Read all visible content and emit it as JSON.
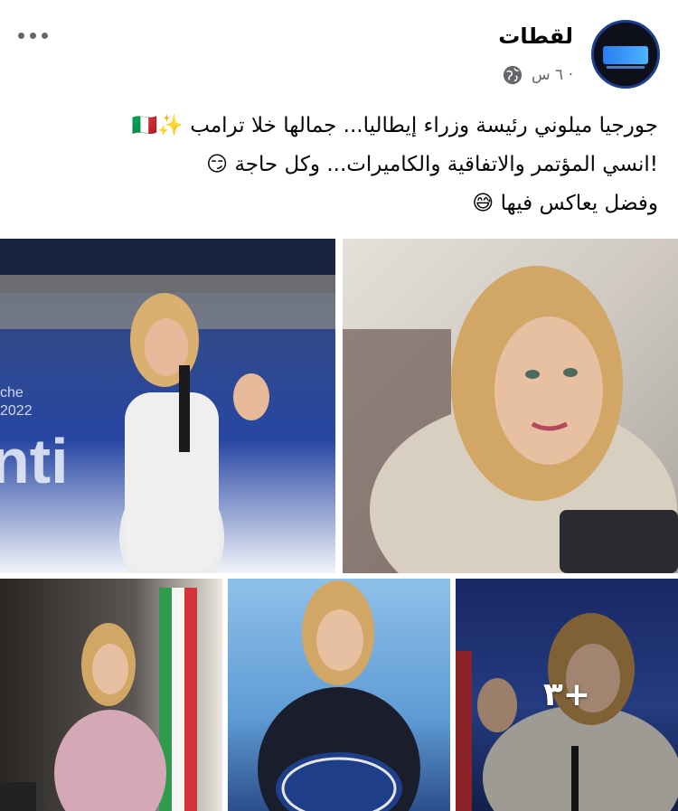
{
  "post": {
    "page_name": "لقطات",
    "time": "٦ س ·",
    "privacy_icon": "globe-icon",
    "more_icon": "more-options-icon",
    "caption": {
      "line1": "جورجيا ميلوني رئيسة وزراء إيطاليا... جمالها خلا ترامب ✨🇮🇹",
      "line2": "!انسي المؤتمر والاتفاقية والكاميرات... وكل حاجة 😏",
      "line3": "وفضل يعاكس فيها 😅"
    }
  },
  "photos": {
    "more_count": "+٣"
  },
  "colors": {
    "text": "#050505",
    "meta": "#65676b",
    "avatar_ring": "#1e3f8f"
  }
}
